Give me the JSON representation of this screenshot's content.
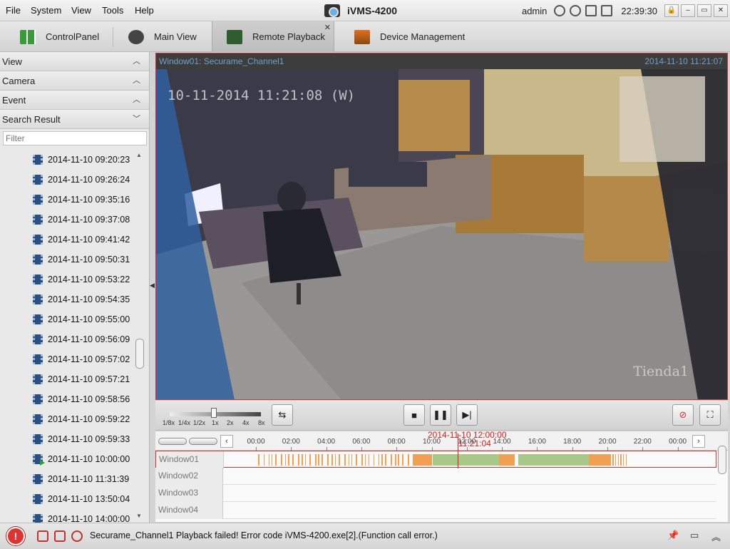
{
  "menu": [
    "File",
    "System",
    "View",
    "Tools",
    "Help"
  ],
  "app_title": "iVMS-4200",
  "user": "admin",
  "clock": "22:39:30",
  "tabs": {
    "control_panel": "ControlPanel",
    "main_view": "Main View",
    "remote_playback": "Remote Playback",
    "device_management": "Device Management"
  },
  "sidebar": {
    "sections": [
      "View",
      "Camera",
      "Event",
      "Search Result"
    ],
    "filter_placeholder": "Filter",
    "results": [
      "2014-11-10 09:20:23",
      "2014-11-10 09:26:24",
      "2014-11-10 09:35:16",
      "2014-11-10 09:37:08",
      "2014-11-10 09:41:42",
      "2014-11-10 09:50:31",
      "2014-11-10 09:53:22",
      "2014-11-10 09:54:35",
      "2014-11-10 09:55:00",
      "2014-11-10 09:56:09",
      "2014-11-10 09:57:02",
      "2014-11-10 09:57:21",
      "2014-11-10 09:58:56",
      "2014-11-10 09:59:22",
      "2014-11-10 09:59:33",
      "2014-11-10 10:00:00",
      "2014-11-10 11:31:39",
      "2014-11-10 13:50:04",
      "2014-11-10 14:00:00"
    ],
    "playing_index": 15
  },
  "video": {
    "window_label": "Window01:  Securame_Channel1",
    "timestamp": "2014-11-10 11:21:07",
    "osd_datetime": "10-11-2014 11:21:08 (W)",
    "osd_name": "Tienda1"
  },
  "speed_labels": [
    "1/8x",
    "1/4x",
    "1/2x",
    "1x",
    "2x",
    "4x",
    "8x"
  ],
  "timeline": {
    "hours": [
      "00:00",
      "02:00",
      "04:00",
      "06:00",
      "08:00",
      "10:00",
      "12:00",
      "14:00",
      "16:00",
      "18:00",
      "20:00",
      "22:00",
      "00:00"
    ],
    "cursor_date": "2014-11-10 12:00:00",
    "cursor_time": "11:21:04",
    "windows": [
      "Window01",
      "Window02",
      "Window03",
      "Window04"
    ]
  },
  "status_message": "Securame_Channel1 Playback failed! Error code iVMS-4200.exe[2].(Function call error.)",
  "colors": {
    "error": "#cc2020",
    "record_motion": "#f0a050",
    "record_continuous": "#a8c888"
  }
}
